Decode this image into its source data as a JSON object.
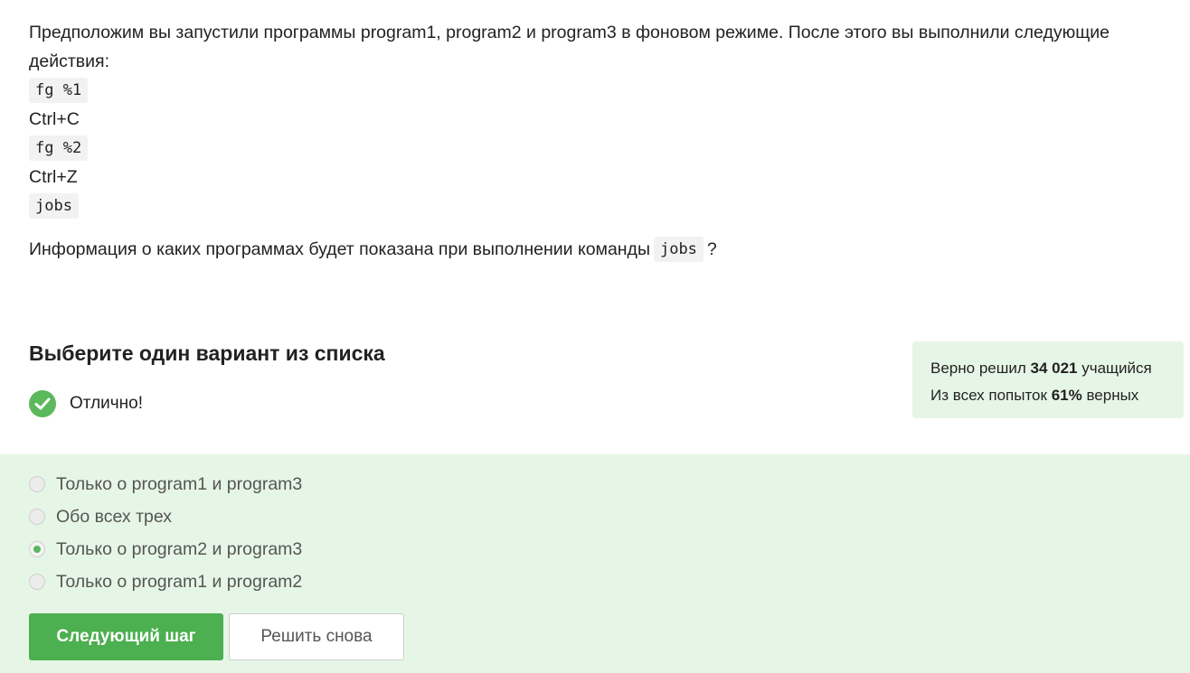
{
  "question": {
    "intro": "Предположим вы запустили программы program1, program2 и program3 в фоновом режиме. После этого вы выполнили следующие действия:",
    "steps": [
      {
        "text": "fg %1",
        "code": true
      },
      {
        "text": "Ctrl+C",
        "code": false
      },
      {
        "text": "fg %2",
        "code": true
      },
      {
        "text": "Ctrl+Z",
        "code": false
      },
      {
        "text": "jobs",
        "code": true
      }
    ],
    "ask_before": "Информация о каких программах будет показана при выполнении команды",
    "ask_code": "jobs",
    "ask_after": "?"
  },
  "section": {
    "title": "Выберите один вариант из списка",
    "status": "Отлично!",
    "status_color": "#5cb85c"
  },
  "stats": {
    "line1_prefix": "Верно решил",
    "solved_count": "34 021",
    "line1_suffix": "учащийся",
    "line2_prefix": "Из всех попыток",
    "percent": "61%",
    "line2_suffix": "верных"
  },
  "options": [
    {
      "label": "Только о program1 и program3",
      "checked": false
    },
    {
      "label": "Обо всех трех",
      "checked": false
    },
    {
      "label": "Только о program2 и program3",
      "checked": true
    },
    {
      "label": "Только о program1 и program2",
      "checked": false
    }
  ],
  "buttons": {
    "next": "Следующий шаг",
    "retry": "Решить снова"
  },
  "colors": {
    "accent": "#4caf50",
    "panel_bg": "#e6f6e6"
  }
}
